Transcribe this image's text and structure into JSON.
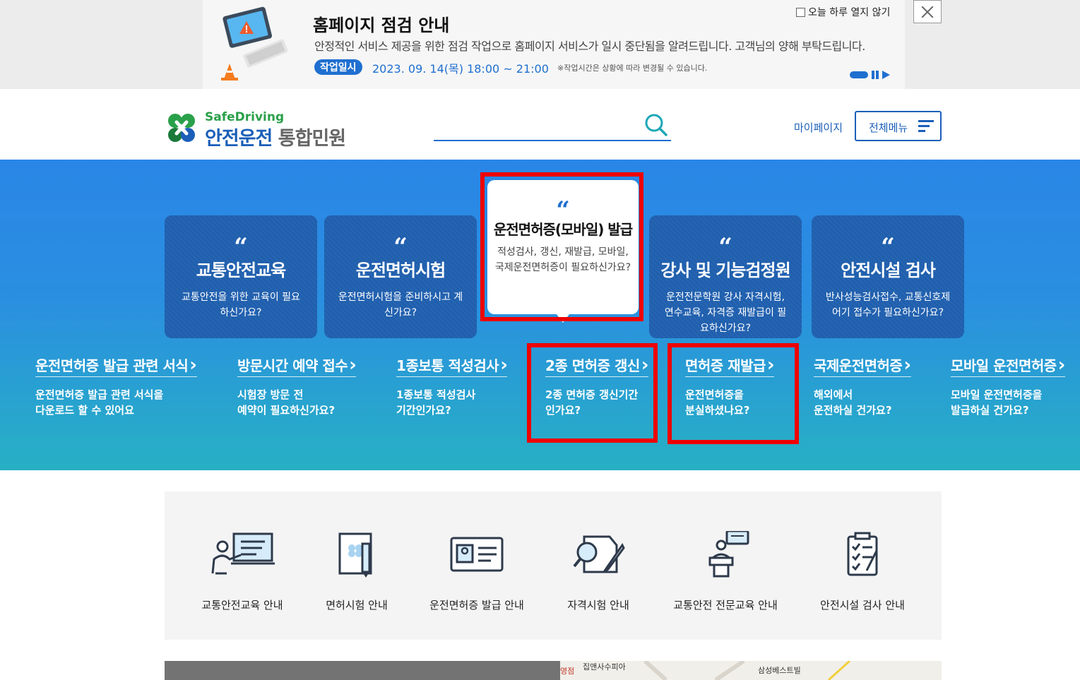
{
  "banner": {
    "title": "홈페이지 점검 안내",
    "description": "안정적인 서비스 제공을 위한 점검 작업으로 홈페이지 서비스가 일시 중단됨을 알려드립니다. 고객님의 양해 부탁드립니다.",
    "work_label": "작업일시",
    "work_time": "2023. 09. 14(목) 18:00 ~ 21:00",
    "work_note": "※작업시간은 상황에 따라 변경될 수 있습니다.",
    "dont_show_today": "오늘 하루 열지 않기",
    "close_icon": "close-icon"
  },
  "header": {
    "logo_en": "SafeDriving",
    "logo_ko_main": "안전운전",
    "logo_ko_sub": "통합민원",
    "search_placeholder": "",
    "mypage": "마이페이지",
    "all_menu": "전체메뉴"
  },
  "cards": [
    {
      "title": "교통안전교육",
      "desc": "교통안전을 위한 교육이 필요하신가요?"
    },
    {
      "title": "운전면허시험",
      "desc": "운전면허시험을 준비하시고 계신가요?"
    },
    {
      "title": "운전면허증(모바일) 발급",
      "desc": "적성검사, 갱신, 재발급, 모바일, 국제운전면허증이 필요하신가요?"
    },
    {
      "title": "강사 및 기능검정원",
      "desc": "운전전문학원 강사 자격시험, 연수교육, 자격증 재발급이 필요하신가요?"
    },
    {
      "title": "안전시설 검사",
      "desc": "반사성능검사접수, 교통신호제어기 접수가 필요하신가요?"
    }
  ],
  "quote_mark": "“",
  "links": [
    {
      "title": "운전면허증 발급 관련 서식",
      "desc1": "운전면허증 발급 관련 서식을",
      "desc2": "다운로드 할 수 있어요"
    },
    {
      "title": "방문시간 예약 접수",
      "desc1": "시험장 방문 전",
      "desc2": "예약이 필요하신가요?"
    },
    {
      "title": "1종보통 적성검사",
      "desc1": "1종보통 적성검사",
      "desc2": "기간인가요?"
    },
    {
      "title": "2종 면허증 갱신",
      "desc1": "2종 면허증 갱신기간",
      "desc2": "인가요?"
    },
    {
      "title": "면허증 재발급",
      "desc1": "운전면허증을",
      "desc2": "분실하셨나요?"
    },
    {
      "title": "국제운전면허증",
      "desc1": "해외에서",
      "desc2": "운전하실 건가요?"
    },
    {
      "title": "모바일 운전면허증",
      "desc1": "모바일 운전면허증을",
      "desc2": "발급하실 건가요?"
    }
  ],
  "quick_menu": [
    {
      "label": "교통안전교육 안내",
      "icon": "teacher-board-icon"
    },
    {
      "label": "면허시험 안내",
      "icon": "document-pen-icon"
    },
    {
      "label": "운전면허증 발급 안내",
      "icon": "id-card-icon"
    },
    {
      "label": "자격시험 안내",
      "icon": "document-magnifier-icon"
    },
    {
      "label": "교통안전 전문교육 안내",
      "icon": "speaker-podium-icon"
    },
    {
      "label": "안전시설 검사 안내",
      "icon": "checklist-icon"
    }
  ],
  "map_labels": [
    "영점",
    "집앤사수피아",
    "삼성베스트빌"
  ],
  "colors": {
    "primary": "#1f6fd0",
    "highlight": "#ee0000",
    "logo_green": "#2aa04a"
  }
}
